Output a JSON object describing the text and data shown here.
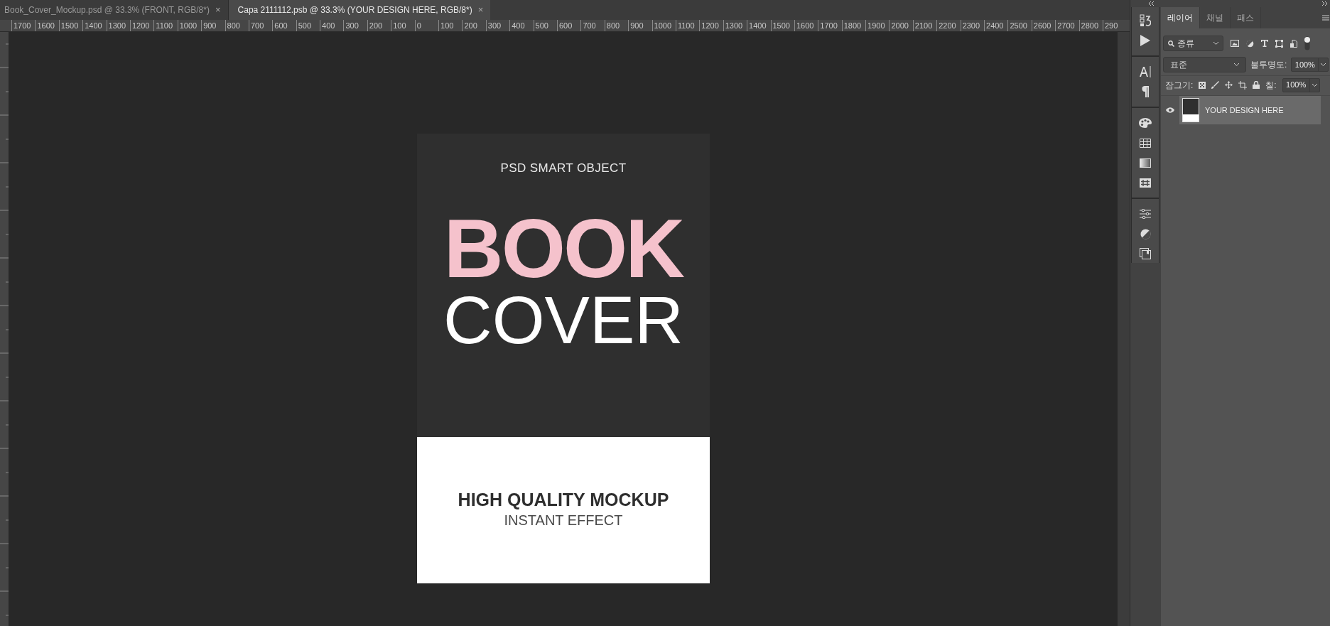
{
  "document_tabs": [
    {
      "label": "Book_Cover_Mockup.psd @ 33.3% (FRONT, RGB/8*)",
      "close": "×",
      "selected": false
    },
    {
      "label": "Capa 2111112.psb @ 33.3% (YOUR DESIGN HERE, RGB/8*)",
      "close": "×",
      "selected": true
    }
  ],
  "ruler": {
    "labels": [
      "1700",
      "1600",
      "1500",
      "1400",
      "1300",
      "1200",
      "1100",
      "1000",
      "900",
      "800",
      "700",
      "600",
      "500",
      "400",
      "300",
      "200",
      "100",
      "0",
      "100",
      "200",
      "300",
      "400",
      "500",
      "600",
      "700",
      "800",
      "900",
      "1000",
      "1100",
      "1200",
      "1300",
      "1400",
      "1500",
      "1600",
      "1700",
      "1800",
      "1900",
      "2000",
      "2100",
      "2200",
      "2300",
      "2400",
      "2500",
      "2600",
      "2700",
      "2800",
      "290"
    ]
  },
  "cover": {
    "kicker": "PSD SMART OBJECT",
    "title_bold": "BOOK",
    "title_light": "COVER",
    "headline": "HIGH QUALITY MOCKUP",
    "subline": "INSTANT EFFECT"
  },
  "layers_panel": {
    "tabs": [
      {
        "label": "레이어",
        "selected": true
      },
      {
        "label": "채널",
        "selected": false
      },
      {
        "label": "패스",
        "selected": false
      }
    ],
    "filter": "종류",
    "filter_on": true,
    "blend_mode": "표준",
    "opacity_label": "불투명도:",
    "opacity": "100%",
    "lock_label": "잠그기:",
    "fill_label": "칠:",
    "fill": "100%",
    "layers": [
      {
        "name": "YOUR DESIGN HERE",
        "visible": true,
        "selected": true
      }
    ]
  }
}
